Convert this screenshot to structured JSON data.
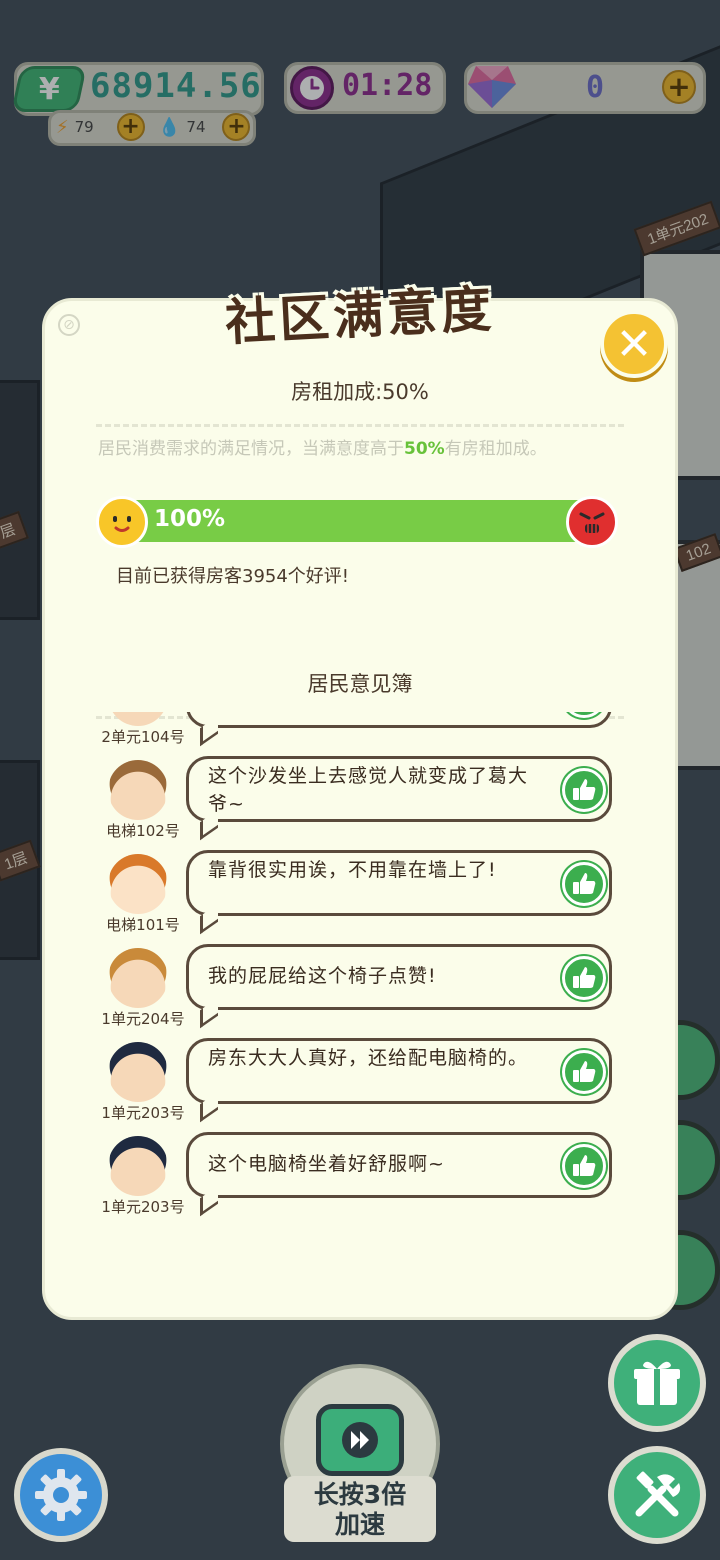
{
  "hud": {
    "money": "68914.56",
    "money_symbol": "¥",
    "energy": "79",
    "water": "74",
    "timer": "01:28",
    "gems": "0"
  },
  "scene": {
    "room_signs": [
      "1单元202",
      "102",
      "1层",
      "层"
    ]
  },
  "dialog": {
    "title": "社区满意度",
    "rent_bonus": "房租加成:50%",
    "description_pre": "居民消费需求的满足情况，当满意度高于",
    "description_hl": "50%",
    "description_post": "有房租加成。",
    "satisfaction_label": "100%",
    "satisfaction_value": 1.0,
    "review_count_text": "目前已获得房客3954个好评!",
    "book_title": "居民意见簿",
    "close_icon": "close-icon"
  },
  "reviews": [
    {
      "unit": "2单元104号",
      "text": "",
      "avatar_color": "#f6d8b8",
      "hair": "#e8e0d0"
    },
    {
      "unit": "电梯102号",
      "text": "这个沙发坐上去感觉人就变成了葛大爷~",
      "avatar_color": "#f6d8b8",
      "hair": "#9a6a3a"
    },
    {
      "unit": "电梯101号",
      "text": "靠背很实用诶，不用靠在墙上了!",
      "avatar_color": "#fbe2c6",
      "hair": "#d9792a"
    },
    {
      "unit": "1单元204号",
      "text": "我的屁屁给这个椅子点赞!",
      "avatar_color": "#f6d8b8",
      "hair": "#c98a3a"
    },
    {
      "unit": "1单元203号",
      "text": "房东大大人真好，还给配电脑椅的。",
      "avatar_color": "#f6d8b8",
      "hair": "#1f2a40"
    },
    {
      "unit": "1单元203号",
      "text": "这个电脑椅坐着好舒服啊~",
      "avatar_color": "#f6d8b8",
      "hair": "#1f2a40"
    }
  ],
  "bottom": {
    "speed_label_line1": "长按3倍",
    "speed_label_line2": "加速"
  },
  "colors": {
    "accent_green": "#78cc46",
    "money_green": "#3fb775",
    "timer_purple": "#8e2a8e",
    "close_yellow": "#f4c233",
    "highlight": "#68c23a"
  }
}
